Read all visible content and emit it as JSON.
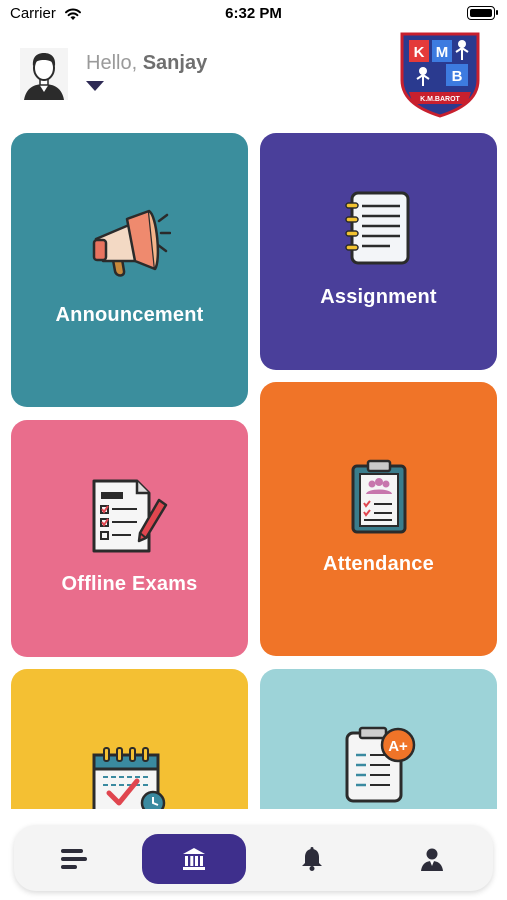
{
  "status_bar": {
    "carrier": "Carrier",
    "time": "6:32 PM",
    "battery_level": 1.0
  },
  "header": {
    "greeting_prefix": "Hello,",
    "user_name": "Sanjay",
    "logo_letters": [
      "K",
      "M",
      "B"
    ],
    "logo_caption": "K.M.BAROT"
  },
  "tiles": [
    {
      "label": "Announcement",
      "color": "#3b8e9d",
      "icon": "megaphone-icon"
    },
    {
      "label": "Assignment",
      "color": "#4a3f9a",
      "icon": "notebook-icon"
    },
    {
      "label": "Offline Exams",
      "color": "#e96d8c",
      "icon": "exam-paper-icon"
    },
    {
      "label": "Attendance",
      "color": "#f07428",
      "icon": "clipboard-icon"
    },
    {
      "label": "",
      "color": "#f4c033",
      "icon": "calendar-icon"
    },
    {
      "label": "",
      "color": "#9dd3d8",
      "icon": "result-sheet-icon"
    }
  ],
  "result_badge": "A+",
  "bottom_nav": {
    "active": "home",
    "items": [
      "menu-icon",
      "institution-icon",
      "bell-icon",
      "profile-icon"
    ],
    "active_color": "#3e2f8c"
  }
}
